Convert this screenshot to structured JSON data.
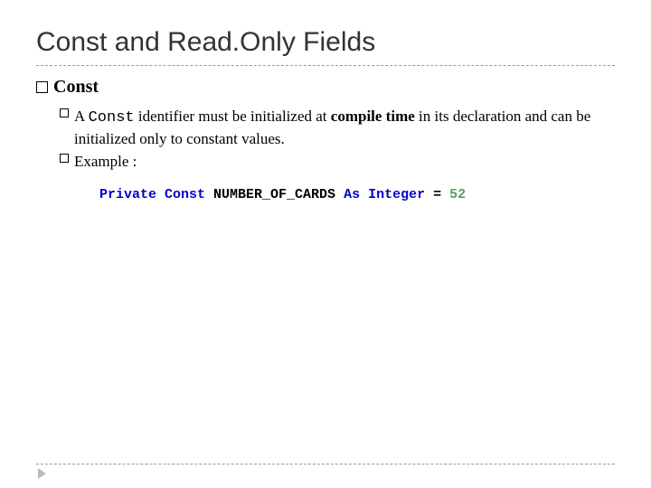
{
  "title": "Const and Read.Only Fields",
  "heading": "Const",
  "bullet1": {
    "pre": "A ",
    "mono": "Const",
    "mid": " identifier must be initialized at ",
    "bold": "compile time",
    "post": " in its declaration and can be initialized only to constant values."
  },
  "bullet2": "Example :",
  "code": {
    "kw1": "Private Const",
    "ident": " NUMBER_OF_CARDS ",
    "kw2": "As Integer",
    "eq": " = ",
    "num": "52"
  }
}
